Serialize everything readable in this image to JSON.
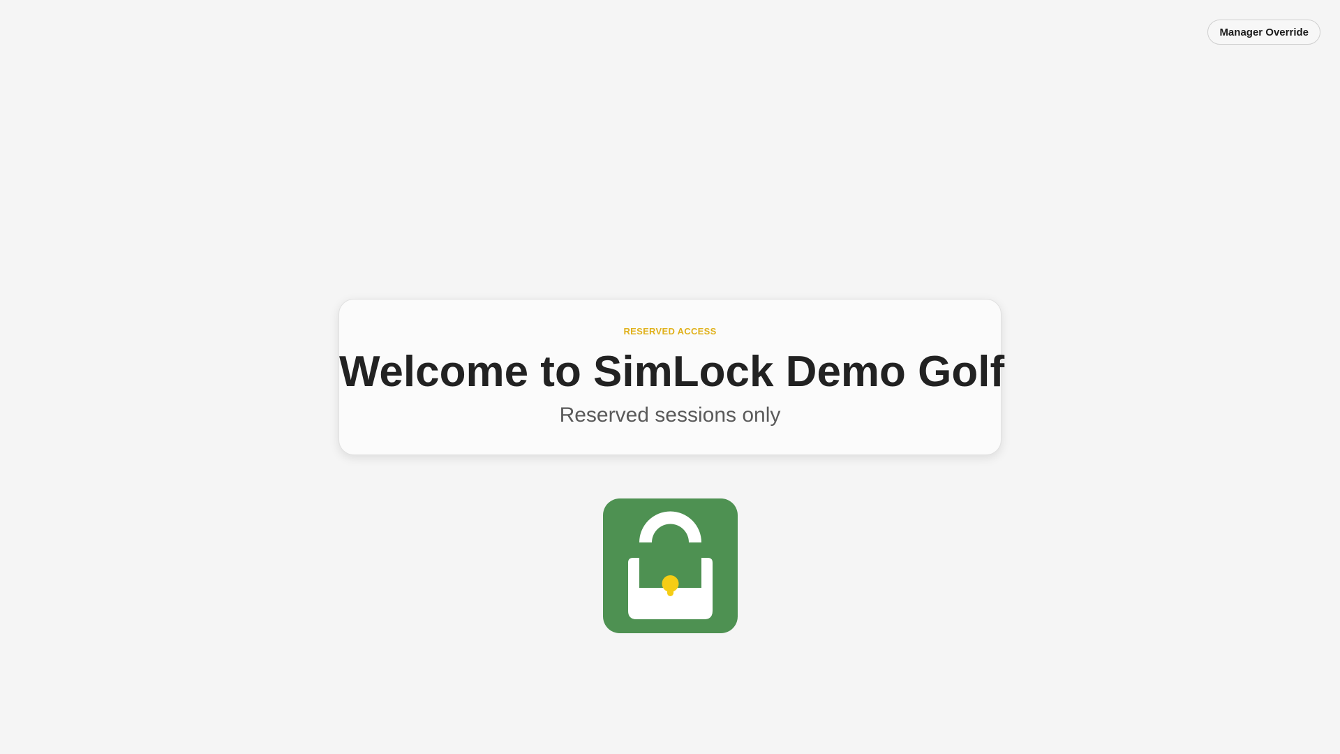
{
  "header": {
    "override_label": "Manager Override"
  },
  "welcome": {
    "eyebrow": "RESERVED ACCESS",
    "title": "Welcome to SimLock Demo Golf",
    "subtitle": "Reserved sessions only"
  },
  "logo": {
    "icon": "padlock-icon",
    "background_color": "#4e9152",
    "lock_color": "#ffffff",
    "keyhole_color": "#f5cd15"
  },
  "colors": {
    "page_background": "#f5f5f5",
    "accent": "#e0b11c",
    "title_text": "#222222",
    "subtitle_text": "#5a5a5a"
  }
}
